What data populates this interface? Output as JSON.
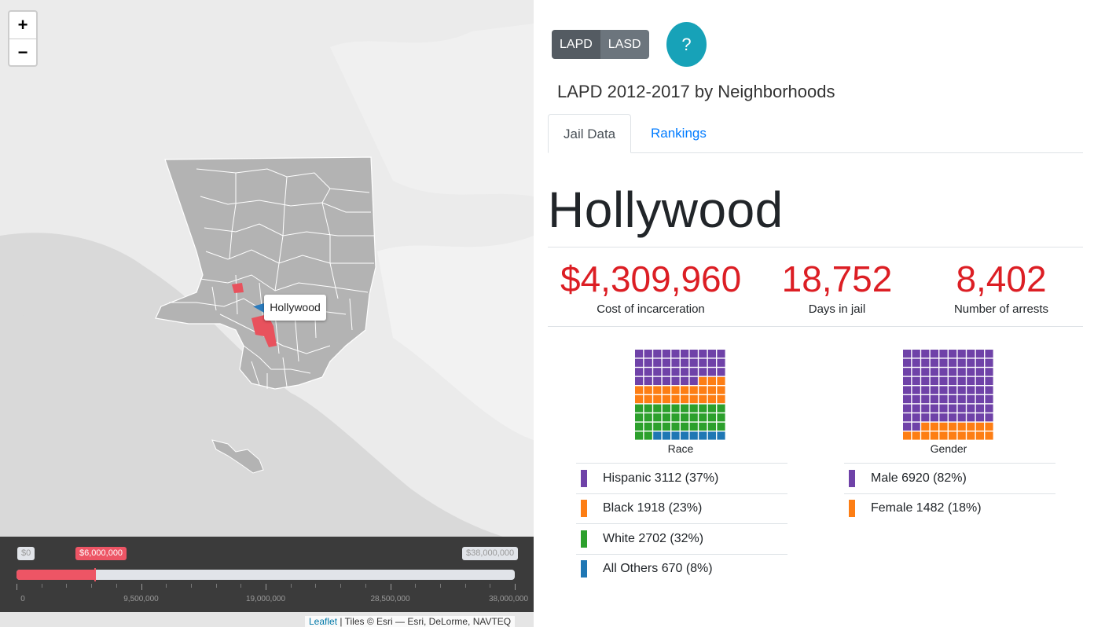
{
  "map": {
    "zoom_in": "+",
    "zoom_out": "−",
    "tooltip": "Hollywood",
    "slider": {
      "min_label": "$0",
      "current_label": "$6,000,000",
      "max_label": "$38,000,000",
      "min": 0,
      "max": 38000000,
      "value": 6000000,
      "tick_labels": [
        "0",
        "9,500,000",
        "19,000,000",
        "28,500,000",
        "38,000,000"
      ]
    },
    "attribution": {
      "link": "Leaflet",
      "rest": " | Tiles © Esri — Esri, DeLorme, NAVTEQ"
    }
  },
  "toggle": {
    "lapd": "LAPD",
    "lasd": "LASD"
  },
  "help": "?",
  "subtitle": "LAPD 2012-2017 by Neighborhoods",
  "tabs": {
    "jail": "Jail Data",
    "rankings": "Rankings"
  },
  "neighborhood": "Hollywood",
  "stats": [
    {
      "value": "$4,309,960",
      "label": "Cost of incarceration"
    },
    {
      "value": "18,752",
      "label": "Days in jail"
    },
    {
      "value": "8,402",
      "label": "Number of arrests"
    }
  ],
  "colors": {
    "hispanic": "#6f42a8",
    "black": "#fd7e14",
    "white": "#2ca02c",
    "others": "#1f77b4",
    "accent": "#dc1e24"
  },
  "race": {
    "title": "Race",
    "items": [
      {
        "label": "Hispanic 3112 (37%)",
        "count": 3112,
        "color": "#6f42a8"
      },
      {
        "label": "Black 1918 (23%)",
        "count": 1918,
        "color": "#fd7e14"
      },
      {
        "label": "White 2702 (32%)",
        "count": 2702,
        "color": "#2ca02c"
      },
      {
        "label": "All Others 670 (8%)",
        "count": 670,
        "color": "#1f77b4"
      }
    ]
  },
  "gender": {
    "title": "Gender",
    "items": [
      {
        "label": "Male 6920 (82%)",
        "count": 6920,
        "color": "#6f42a8"
      },
      {
        "label": "Female 1482 (18%)",
        "count": 1482,
        "color": "#fd7e14"
      }
    ]
  }
}
